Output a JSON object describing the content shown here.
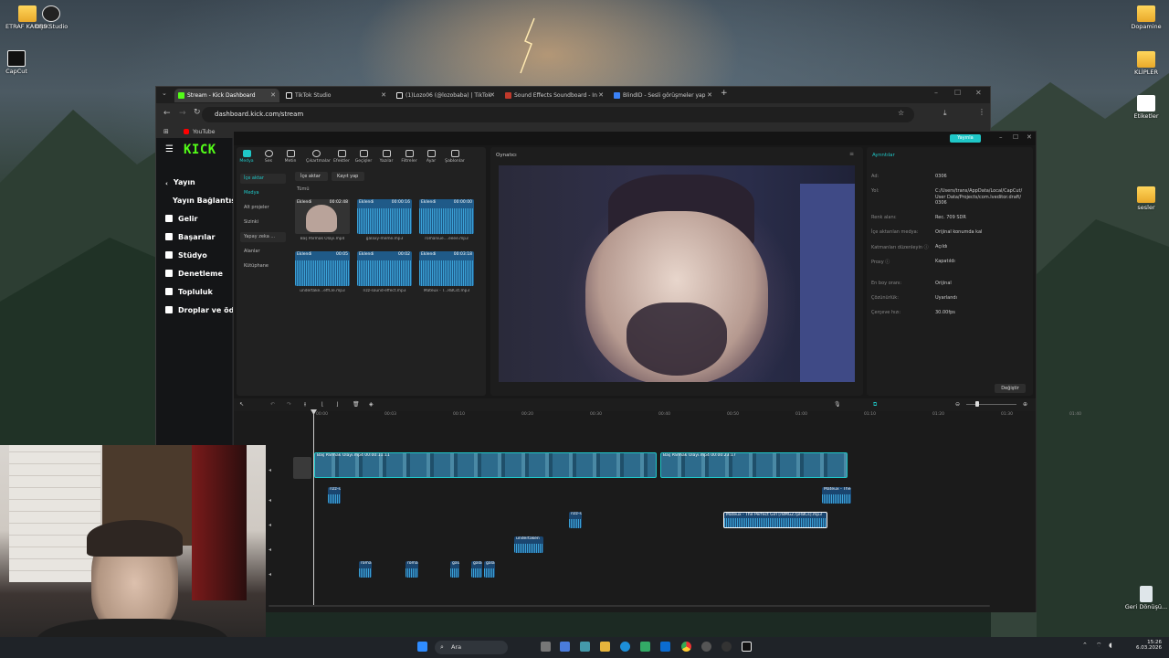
{
  "desktop": {
    "left_icons": [
      {
        "label": "ETRAF KARIŞIK"
      },
      {
        "label": "OBS Studio"
      },
      {
        "label": "CapCut"
      }
    ],
    "right_icons": [
      {
        "label": "Dopamine"
      },
      {
        "label": "KLİPLER"
      },
      {
        "label": "Etiketler"
      },
      {
        "label": "sesler"
      },
      {
        "label": "Geri Dönüşü..."
      }
    ]
  },
  "browser": {
    "tabs": [
      {
        "label": "Stream - Kick Dashboard",
        "active": true
      },
      {
        "label": "TikTok Studio"
      },
      {
        "label": "(1)Lozo06 (@lozobaba) | TikTok"
      },
      {
        "label": "Sound Effects Soundboard - In"
      },
      {
        "label": "BlindID - Sesli görüşmeler yap"
      }
    ],
    "url": "dashboard.kick.com/stream",
    "bookmark": "YouTube",
    "colors": {
      "accent": "#53fc18"
    }
  },
  "kick": {
    "logo": "KICK",
    "nav": [
      {
        "label": "Yayın",
        "icon": "broadcast-icon"
      },
      {
        "label": "Yayın Bağlantısı",
        "icon": ""
      },
      {
        "label": "Gelir",
        "icon": "money-icon"
      },
      {
        "label": "Başarılar",
        "icon": "trophy-icon"
      },
      {
        "label": "Stüdyo",
        "icon": "studio-icon"
      },
      {
        "label": "Denetleme",
        "icon": "shield-icon"
      },
      {
        "label": "Topluluk",
        "icon": "users-icon"
      },
      {
        "label": "Droplar ve ödü",
        "icon": "gift-icon"
      }
    ]
  },
  "capcut": {
    "export_label": "Yayınla",
    "toolbar": [
      {
        "label": "Medya",
        "active": true
      },
      {
        "label": "Ses"
      },
      {
        "label": "Metin"
      },
      {
        "label": "Çıkartmalar"
      },
      {
        "label": "Efektler"
      },
      {
        "label": "Geçişler"
      },
      {
        "label": "Yazılar"
      },
      {
        "label": "Filtreler"
      },
      {
        "label": "Ayar"
      },
      {
        "label": "Şablonlar"
      }
    ],
    "side": [
      {
        "label": "İçe aktar"
      },
      {
        "label": "Medya"
      },
      {
        "label": "Alt projeler"
      },
      {
        "label": "Sizinki"
      },
      {
        "label": "Yapay zeka ..."
      },
      {
        "label": "Alanlar"
      },
      {
        "label": "Kütüphane"
      }
    ],
    "import_btn": "İçe aktar",
    "record_btn": "Kayıt yap",
    "filter_all": "Tümü",
    "media": [
      {
        "name": "Baş Parmak Olayı.mp4",
        "badge": "Eklendi",
        "duration": "00:02:48",
        "type": "video"
      },
      {
        "name": "galaxy-meme.mp3",
        "badge": "Eklendi",
        "duration": "00:00:16",
        "type": "audio"
      },
      {
        "name": "romanıue....eeee.mp3",
        "badge": "Eklendi",
        "duration": "00:00:00",
        "type": "audio"
      },
      {
        "name": "undertake...effCle.mp3",
        "badge": "Eklendi",
        "duration": "00:05",
        "type": "audio"
      },
      {
        "name": "rizz-sound-effect.mp3",
        "badge": "Eklendi",
        "duration": "00:02",
        "type": "audio"
      },
      {
        "name": "Mateux - T...RBCst.mp3",
        "badge": "Eklendi",
        "duration": "00:03:18",
        "type": "audio"
      }
    ],
    "player_title": "Oynatıcı",
    "details": {
      "title": "Ayrıntılar",
      "rows": [
        {
          "k": "Ad:",
          "v": "0306"
        },
        {
          "k": "Yol:",
          "v": "C:/Users/trans/AppData/Local/CapCut/\nUser Data/Projects/com.lveditor.draft/\n0306"
        },
        {
          "k": "Renk alanı:",
          "v": "Rec. 709 SDR"
        },
        {
          "k": "İçe aktarılan medya:",
          "v": "Orijinal konumda kal"
        },
        {
          "k": "Katmanları düzenleyin ⓘ",
          "v": "Açıldı"
        },
        {
          "k": "Proxy ⓘ",
          "v": "Kapatıldı"
        },
        {
          "k": "En boy oranı:",
          "v": "Orijinal"
        },
        {
          "k": "Çözünürlük:",
          "v": "Uyarlandı"
        },
        {
          "k": "Çerçeve hızı:",
          "v": "30.00fps"
        }
      ],
      "change_btn": "Değiştir"
    },
    "timeline": {
      "ruler": [
        "00:00",
        "00:03",
        "00:10",
        "00:20",
        "00:30",
        "00:40",
        "00:50",
        "01:00",
        "01:10",
        "01:20",
        "01:30",
        "01:40"
      ],
      "video_label": "Baş Parmak Olayı.mp4  00:00:11:11",
      "video_label2": "Baş Parmak Olayı.mp4  00:00:23:17",
      "audio": [
        {
          "label": "rizz-s"
        },
        {
          "label": "Mateux - The"
        },
        {
          "label": "rizz-s"
        },
        {
          "label": "Mateux - The Perfect Girl [r8MGZ7pRBCs].mp3"
        },
        {
          "label": "undertaken"
        },
        {
          "label": "roma"
        },
        {
          "label": "roma"
        },
        {
          "label": "gala"
        },
        {
          "label": "gala"
        },
        {
          "label": "gala"
        }
      ]
    }
  },
  "taskbar": {
    "search": "Ara",
    "time": "15:26",
    "date": "6.03.2026"
  }
}
